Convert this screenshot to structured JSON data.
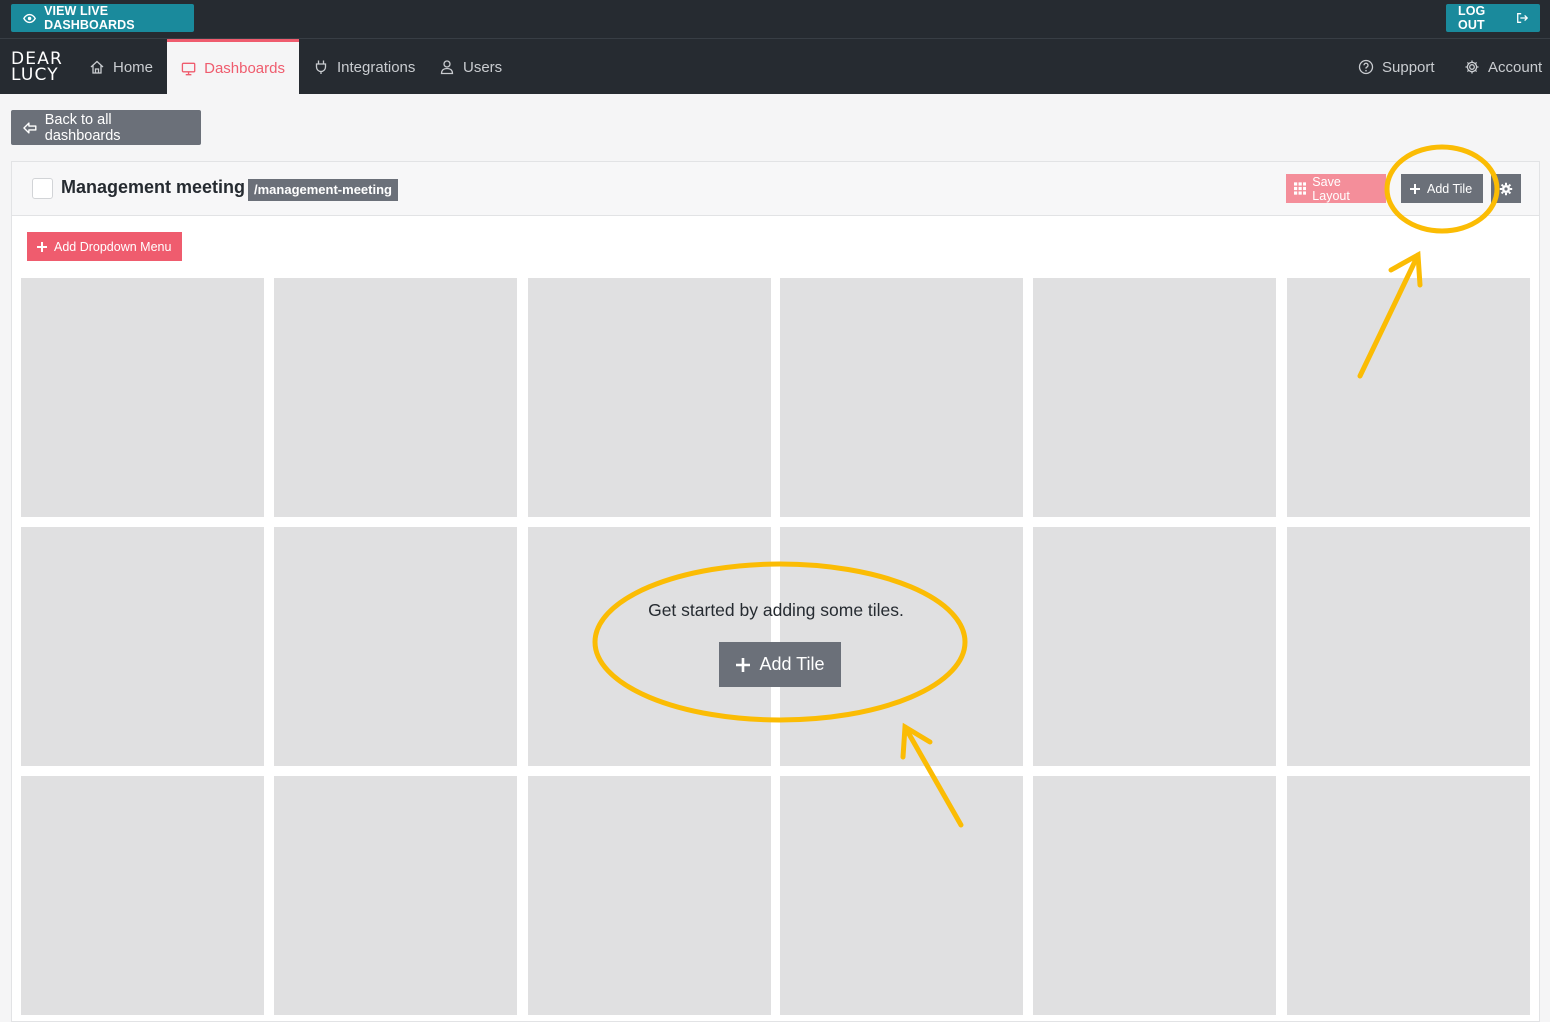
{
  "topbar": {
    "view_live_label": "VIEW LIVE DASHBOARDS",
    "logout_label": "LOG OUT"
  },
  "logo": {
    "line1": "DEAR",
    "line2": "LUCY"
  },
  "nav": {
    "home": "Home",
    "dashboards": "Dashboards",
    "integrations": "Integrations",
    "users": "Users",
    "support": "Support",
    "account": "Account"
  },
  "back_label": "Back to all dashboards",
  "dashboard": {
    "title": "Management meeting",
    "slug": "/management-meeting",
    "save_layout_label": "Save Layout",
    "add_tile_label": "Add Tile",
    "add_dropdown_label": "Add Dropdown Menu"
  },
  "empty_state": {
    "message": "Get started by adding some tiles.",
    "add_tile_label": "Add Tile"
  },
  "colors": {
    "nav_bg": "#262b31",
    "teal": "#1a8a9c",
    "accent": "#ef5c6e",
    "gray_button": "#6b7079",
    "tile": "#e0e0e1",
    "annotation": "#fbbc04"
  }
}
